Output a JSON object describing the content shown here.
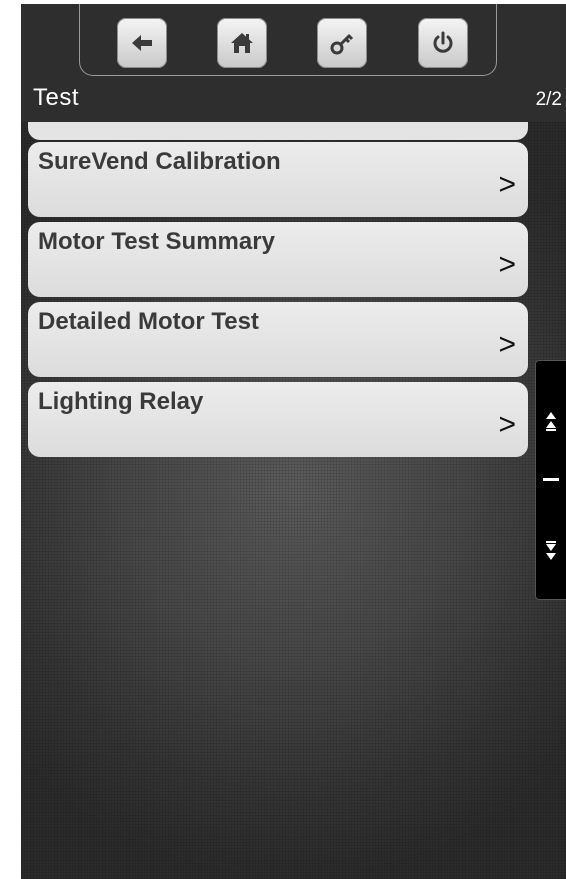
{
  "header": {
    "title": "Test",
    "page_indicator": "2/2"
  },
  "nav_buttons": [
    {
      "name": "back",
      "icon": "arrow-left-icon"
    },
    {
      "name": "home",
      "icon": "home-icon"
    },
    {
      "name": "key",
      "icon": "key-icon"
    },
    {
      "name": "power",
      "icon": "power-icon"
    }
  ],
  "menu": {
    "items": [
      {
        "label": "SureVend Calibration",
        "chevron": ">"
      },
      {
        "label": "Motor Test Summary",
        "chevron": ">"
      },
      {
        "label": "Detailed Motor Test",
        "chevron": ">"
      },
      {
        "label": "Lighting Relay",
        "chevron": ">"
      }
    ]
  },
  "scrollbar": {
    "up_icon": "double-chevron-up-icon",
    "down_icon": "double-chevron-down-icon"
  },
  "colors": {
    "background": "#3f3f3f",
    "topbar": "#2e2e2e",
    "item_bg": "#e4e4e4",
    "item_text": "#3a3a3a"
  }
}
